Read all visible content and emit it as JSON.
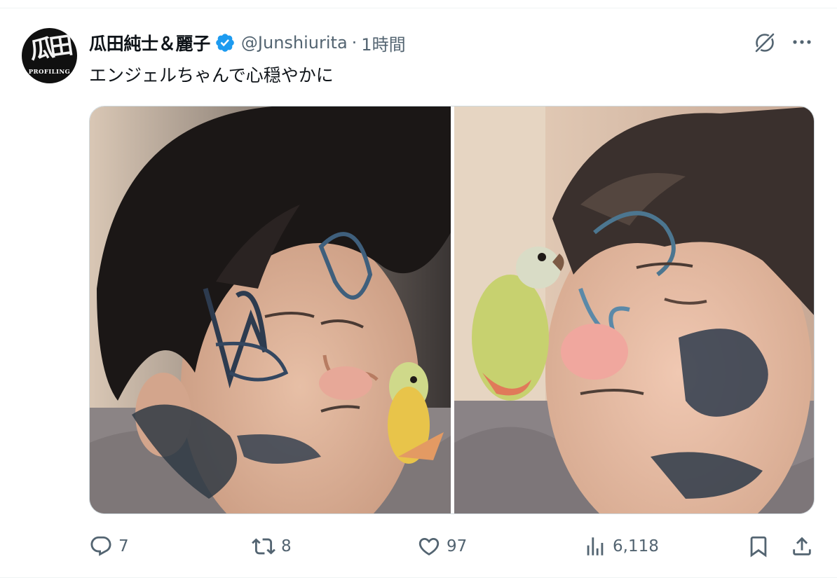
{
  "tweet": {
    "author": {
      "display_name": "瓜田純士＆麗子",
      "handle": "@Junshiurita",
      "time": "1時間",
      "separator": "·",
      "avatar": {
        "logo_text": "PROFILING",
        "icon": "avatar-logo"
      },
      "verified_icon": "verified-badge-icon",
      "verified_color": "#1d9bf0"
    },
    "text": "エンジェルちゃんで心穏やかに",
    "top_icons": [
      "grok-icon",
      "more-icon"
    ],
    "media": [
      {
        "name": "photo-1",
        "icon": "photo"
      },
      {
        "name": "photo-2",
        "icon": "photo"
      }
    ],
    "actions": {
      "reply": {
        "icon": "reply-icon",
        "count": "7"
      },
      "retweet": {
        "icon": "retweet-icon",
        "count": "8"
      },
      "like": {
        "icon": "heart-icon",
        "count": "97"
      },
      "views": {
        "icon": "views-icon",
        "count": "6,118"
      },
      "bookmark": {
        "icon": "bookmark-icon"
      },
      "share": {
        "icon": "share-icon"
      }
    },
    "colors": {
      "text_primary": "#0f1419",
      "text_secondary": "#536471",
      "divider": "#eff3f4",
      "media_border": "#cfd9de"
    }
  }
}
